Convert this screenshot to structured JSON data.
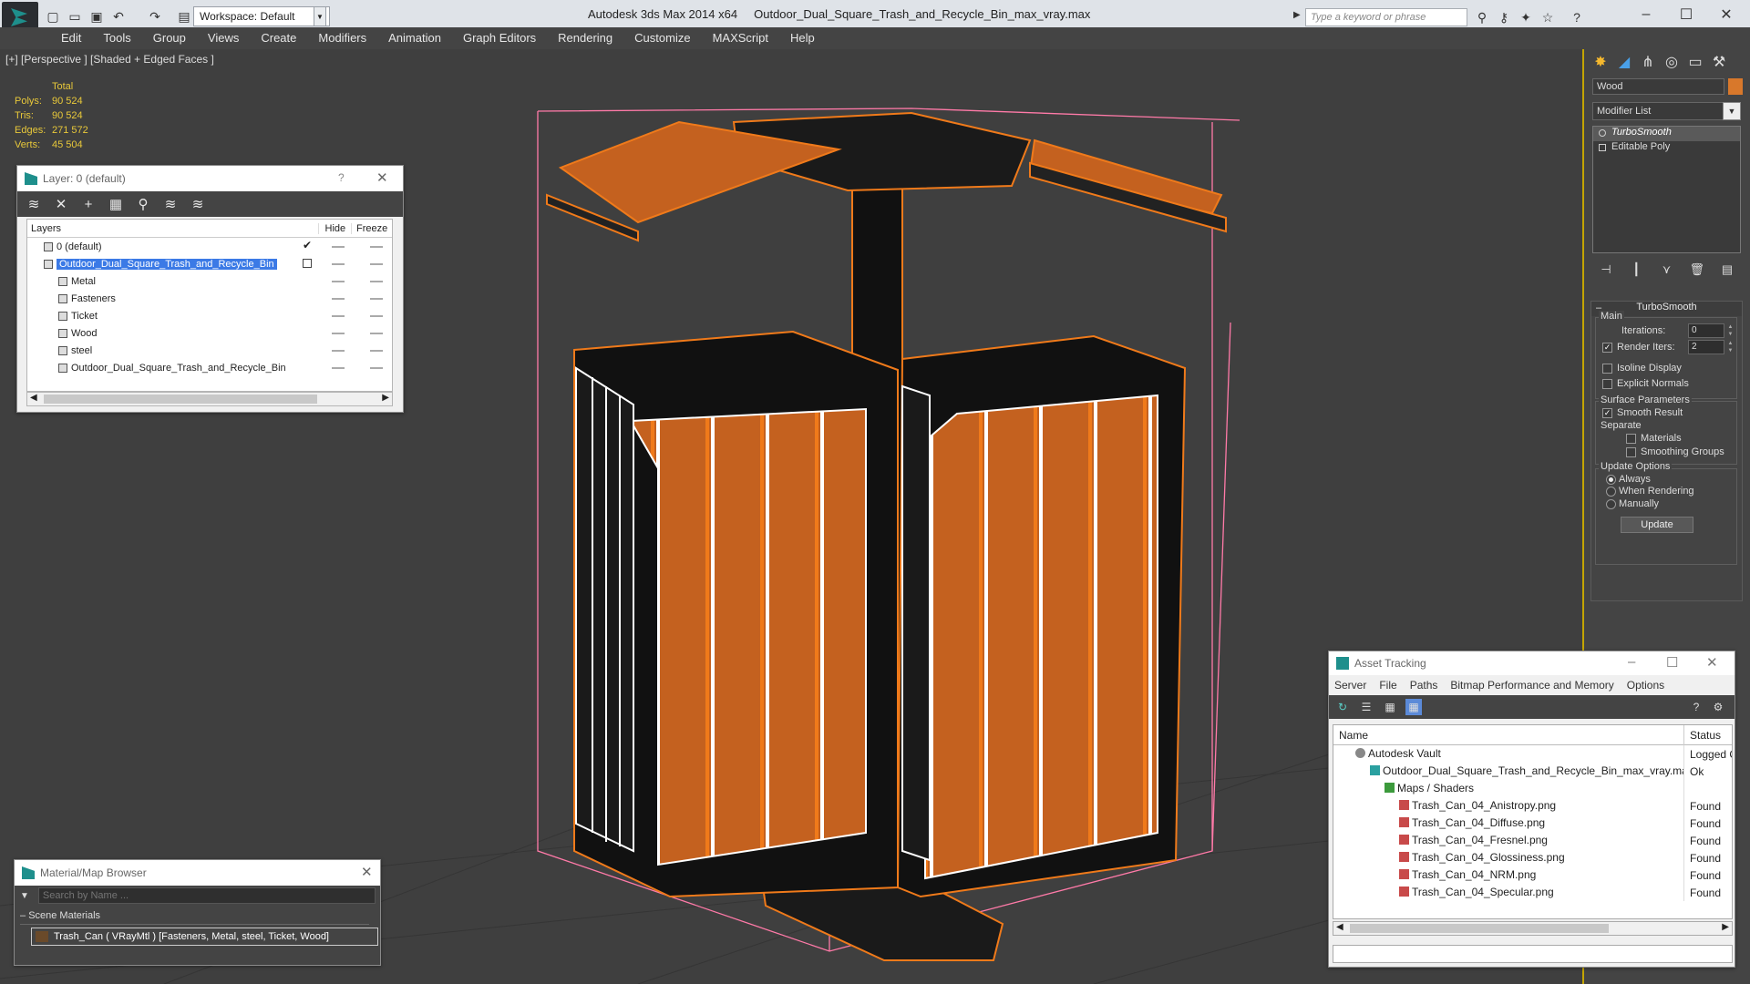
{
  "titlebar": {
    "workspace": "Workspace: Default",
    "app_title": "Autodesk 3ds Max  2014 x64",
    "file_title": "Outdoor_Dual_Square_Trash_and_Recycle_Bin_max_vray.max",
    "search_placeholder": "Type a keyword or phrase"
  },
  "menu": [
    "Edit",
    "Tools",
    "Group",
    "Views",
    "Create",
    "Modifiers",
    "Animation",
    "Graph Editors",
    "Rendering",
    "Customize",
    "MAXScript",
    "Help"
  ],
  "viewport": {
    "label": "[+] [Perspective ] [Shaded + Edged Faces ]",
    "stats": {
      "header": "Total",
      "rows": [
        {
          "k": "Polys:",
          "v": "90 524"
        },
        {
          "k": "Tris:",
          "v": "90 524"
        },
        {
          "k": "Edges:",
          "v": "271 572"
        },
        {
          "k": "Verts:",
          "v": "45 504"
        }
      ]
    },
    "colors": {
      "background": "#3f3f3f",
      "wireframe": "#f07a1a",
      "wood": "#c4611f",
      "selection_box": "#ff7aa8"
    }
  },
  "layer_panel": {
    "title": "Layer: 0 (default)",
    "help": "?",
    "columns": [
      "Layers",
      "Hide",
      "Freeze"
    ],
    "rows": [
      {
        "name": "0 (default)",
        "indent": 0,
        "selected": false,
        "active": true
      },
      {
        "name": "Outdoor_Dual_Square_Trash_and_Recycle_Bin",
        "indent": 0,
        "selected": true,
        "active": false
      },
      {
        "name": "Metal",
        "indent": 1,
        "selected": false,
        "active": false
      },
      {
        "name": "Fasteners",
        "indent": 1,
        "selected": false,
        "active": false
      },
      {
        "name": "Ticket",
        "indent": 1,
        "selected": false,
        "active": false
      },
      {
        "name": "Wood",
        "indent": 1,
        "selected": false,
        "active": false
      },
      {
        "name": "steel",
        "indent": 1,
        "selected": false,
        "active": false
      },
      {
        "name": "Outdoor_Dual_Square_Trash_and_Recycle_Bin",
        "indent": 1,
        "selected": false,
        "active": false
      }
    ]
  },
  "material_browser": {
    "title": "Material/Map Browser",
    "search_placeholder": "Search by Name ...",
    "group": "Scene Materials",
    "item": "Trash_Can  ( VRayMtl )  [Fasteners, Metal, steel, Ticket, Wood]"
  },
  "command_panel": {
    "object_name": "Wood",
    "object_color": "#d8782b",
    "modifier_list": "Modifier List",
    "stack": [
      "TurboSmooth",
      "Editable Poly"
    ],
    "rollout": {
      "title": "TurboSmooth",
      "main_label": "Main",
      "iterations_label": "Iterations:",
      "iterations_value": "0",
      "render_iters_label": "Render Iters:",
      "render_iters_value": "2",
      "isoline": "Isoline Display",
      "explicit": "Explicit Normals",
      "surface_label": "Surface Parameters",
      "smooth_result": "Smooth Result",
      "separate_label": "Separate",
      "materials": "Materials",
      "smoothing_groups": "Smoothing Groups",
      "update_label": "Update Options",
      "always": "Always",
      "when_rendering": "When Rendering",
      "manually": "Manually",
      "update_button": "Update"
    }
  },
  "asset_tracking": {
    "title": "Asset Tracking",
    "menu": [
      "Server",
      "File",
      "Paths",
      "Bitmap Performance and Memory",
      "Options"
    ],
    "columns": [
      "Name",
      "Status"
    ],
    "rows": [
      {
        "name": "Autodesk Vault",
        "status": "Logged O",
        "indent": 1,
        "icon": "vault"
      },
      {
        "name": "Outdoor_Dual_Square_Trash_and_Recycle_Bin_max_vray.max",
        "status": "Ok",
        "indent": 2,
        "icon": "max"
      },
      {
        "name": "Maps / Shaders",
        "status": "",
        "indent": 3,
        "icon": "maps"
      },
      {
        "name": "Trash_Can_04_Anistropy.png",
        "status": "Found",
        "indent": 4,
        "icon": "png"
      },
      {
        "name": "Trash_Can_04_Diffuse.png",
        "status": "Found",
        "indent": 4,
        "icon": "png"
      },
      {
        "name": "Trash_Can_04_Fresnel.png",
        "status": "Found",
        "indent": 4,
        "icon": "png"
      },
      {
        "name": "Trash_Can_04_Glossiness.png",
        "status": "Found",
        "indent": 4,
        "icon": "png"
      },
      {
        "name": "Trash_Can_04_NRM.png",
        "status": "Found",
        "indent": 4,
        "icon": "png"
      },
      {
        "name": "Trash_Can_04_Specular.png",
        "status": "Found",
        "indent": 4,
        "icon": "png"
      }
    ]
  }
}
